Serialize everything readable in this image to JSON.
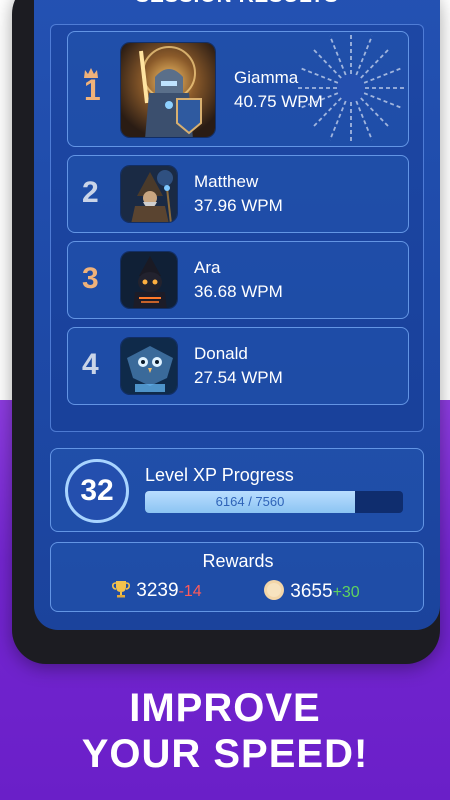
{
  "screen": {
    "title": "SESSION RESULTS"
  },
  "results": [
    {
      "rank": "1",
      "name": "Giamma",
      "wpm": "40.75 WPM",
      "avatar": "paladin-knight-avatar",
      "crown": true
    },
    {
      "rank": "2",
      "name": "Matthew",
      "wpm": "37.96 WPM",
      "avatar": "wizard-avatar"
    },
    {
      "rank": "3",
      "name": "Ara",
      "wpm": "36.68 WPM",
      "avatar": "cat-mage-avatar"
    },
    {
      "rank": "4",
      "name": "Donald",
      "wpm": "27.54 WPM",
      "avatar": "owl-avatar"
    }
  ],
  "xp": {
    "level": "32",
    "label": "Level XP Progress",
    "progress_text": "6164 / 7560",
    "progress_fraction": 0.815
  },
  "rewards": {
    "title": "Rewards",
    "trophies": "3239",
    "trophies_delta": "-14",
    "coins": "3655",
    "coins_delta": "+30",
    "trophy_icon": "trophy-icon",
    "coin_icon": "coin-icon"
  },
  "headline": {
    "line1": "IMPROVE",
    "line2": "YOUR SPEED!"
  },
  "colors": {
    "screen_blue": "#1e4aa8",
    "purple_bg": "#7426d0",
    "gold_rank": "#f0b27a",
    "negative": "#ff5a5a",
    "positive": "#5fd35f"
  }
}
